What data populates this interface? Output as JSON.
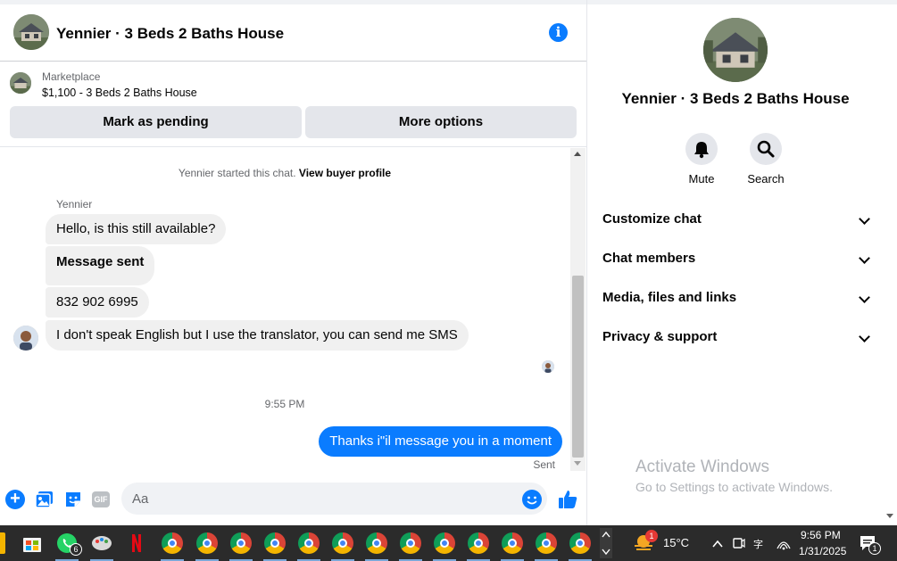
{
  "chat": {
    "title": "Yennier · 3 Beds 2 Baths House",
    "marketplace_label": "Marketplace",
    "listing": "$1,100 - 3 Beds 2 Baths House",
    "buttons": {
      "pending": "Mark as pending",
      "more": "More options"
    },
    "started_text": "Yennier started this chat.",
    "view_profile": "View buyer profile",
    "sender_name": "Yennier",
    "messages": [
      "Hello, is this still available?",
      "Message sent",
      "832 902 6995",
      "I don't speak English but I use the translator, you can send me SMS"
    ],
    "time_separator": "9:55 PM",
    "my_message": "Thanks i\"il message you in a moment",
    "status": "Sent",
    "composer_placeholder": "Aa",
    "gif_label": "GIF"
  },
  "side": {
    "title": "Yennier · 3 Beds 2 Baths House",
    "actions": {
      "mute": "Mute",
      "search": "Search"
    },
    "sections": [
      "Customize chat",
      "Chat members",
      "Media, files and links",
      "Privacy & support"
    ],
    "activate_title": "Activate Windows",
    "activate_sub": "Go to Settings to activate Windows."
  },
  "taskbar": {
    "whatsapp_badge": "6",
    "weather_badge": "1",
    "temperature": "15°C",
    "time": "9:56 PM",
    "date": "1/31/2025",
    "notification_count": "1"
  },
  "colors": {
    "accent": "#0a7cff",
    "bubble_gray": "#f0f0f0",
    "button_gray": "#e4e6eb"
  }
}
